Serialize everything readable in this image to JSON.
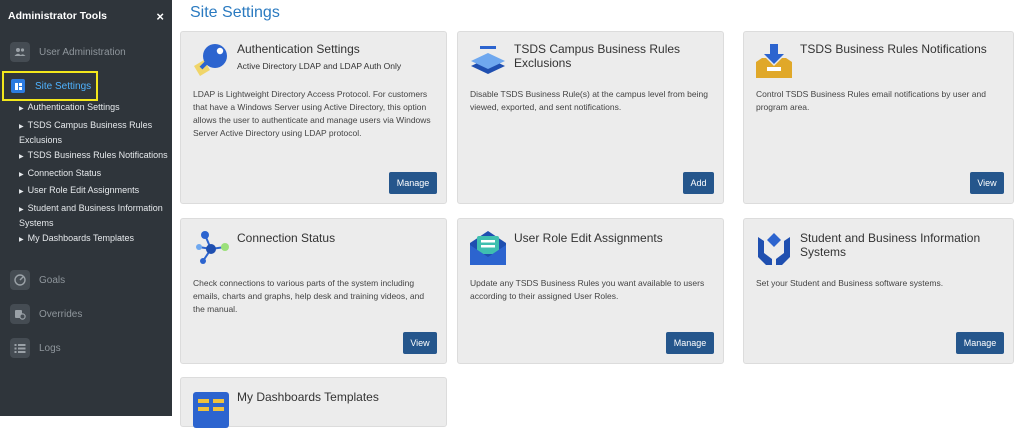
{
  "sidebar": {
    "title": "Administrator Tools",
    "close": "×",
    "items": [
      {
        "label": "User Administration"
      },
      {
        "label": "Site Settings"
      },
      {
        "label": "Goals"
      },
      {
        "label": "Overrides"
      },
      {
        "label": "Logs"
      }
    ],
    "sub_items": [
      "Authentication Settings",
      "TSDS Campus Business Rules Exclusions",
      "TSDS Business Rules Notifications",
      "Connection Status",
      "User Role Edit Assignments",
      "Student and Business Information Systems",
      "My Dashboards Templates"
    ]
  },
  "main": {
    "title": "Site Settings",
    "cards": [
      {
        "title": "Authentication Settings",
        "subtitle": "Active Directory LDAP and LDAP Auth Only",
        "description": "LDAP is Lightweight Directory Access Protocol. For customers that have a Windows Server using Active Directory, this option allows the user to authenticate and manage users via Windows Server Active Directory using LDAP protocol.",
        "button": "Manage"
      },
      {
        "title": "TSDS Campus Business Rules Exclusions",
        "subtitle": "",
        "description": "Disable TSDS Business Rule(s) at the campus level from being viewed, exported, and sent notifications.",
        "button": "Add"
      },
      {
        "title": "TSDS Business Rules Notifications",
        "subtitle": "",
        "description": "Control TSDS Business Rules email notifications by user and program area.",
        "button": "View"
      },
      {
        "title": "Connection Status",
        "subtitle": "",
        "description": "Check connections to various parts of the system including emails, charts and graphs, help desk and training videos, and the manual.",
        "button": "View"
      },
      {
        "title": "User Role Edit Assignments",
        "subtitle": "",
        "description": "Update any TSDS Business Rules you want available to users according to their assigned User Roles.",
        "button": "Manage"
      },
      {
        "title": "Student and Business Information Systems",
        "subtitle": "",
        "description": "Set your Student and Business software systems.",
        "button": "Manage"
      },
      {
        "title": "My Dashboards Templates",
        "subtitle": "",
        "description": "",
        "button": ""
      }
    ]
  },
  "icons": {
    "auth": "ldap-key-icon",
    "exclusions": "stacked-layers-icon",
    "notifications": "inbox-download-icon",
    "connection": "network-nodes-icon",
    "roles": "envelope-list-icon",
    "systems": "hands-diamond-icon",
    "dashboards": "dashboard-grid-icon"
  },
  "colors": {
    "sidebar_bg": "#2f353b",
    "accent_blue": "#2a7ac0",
    "button_blue": "#25568c",
    "highlight_yellow": "#f3e71c",
    "card_bg": "#ececec"
  }
}
